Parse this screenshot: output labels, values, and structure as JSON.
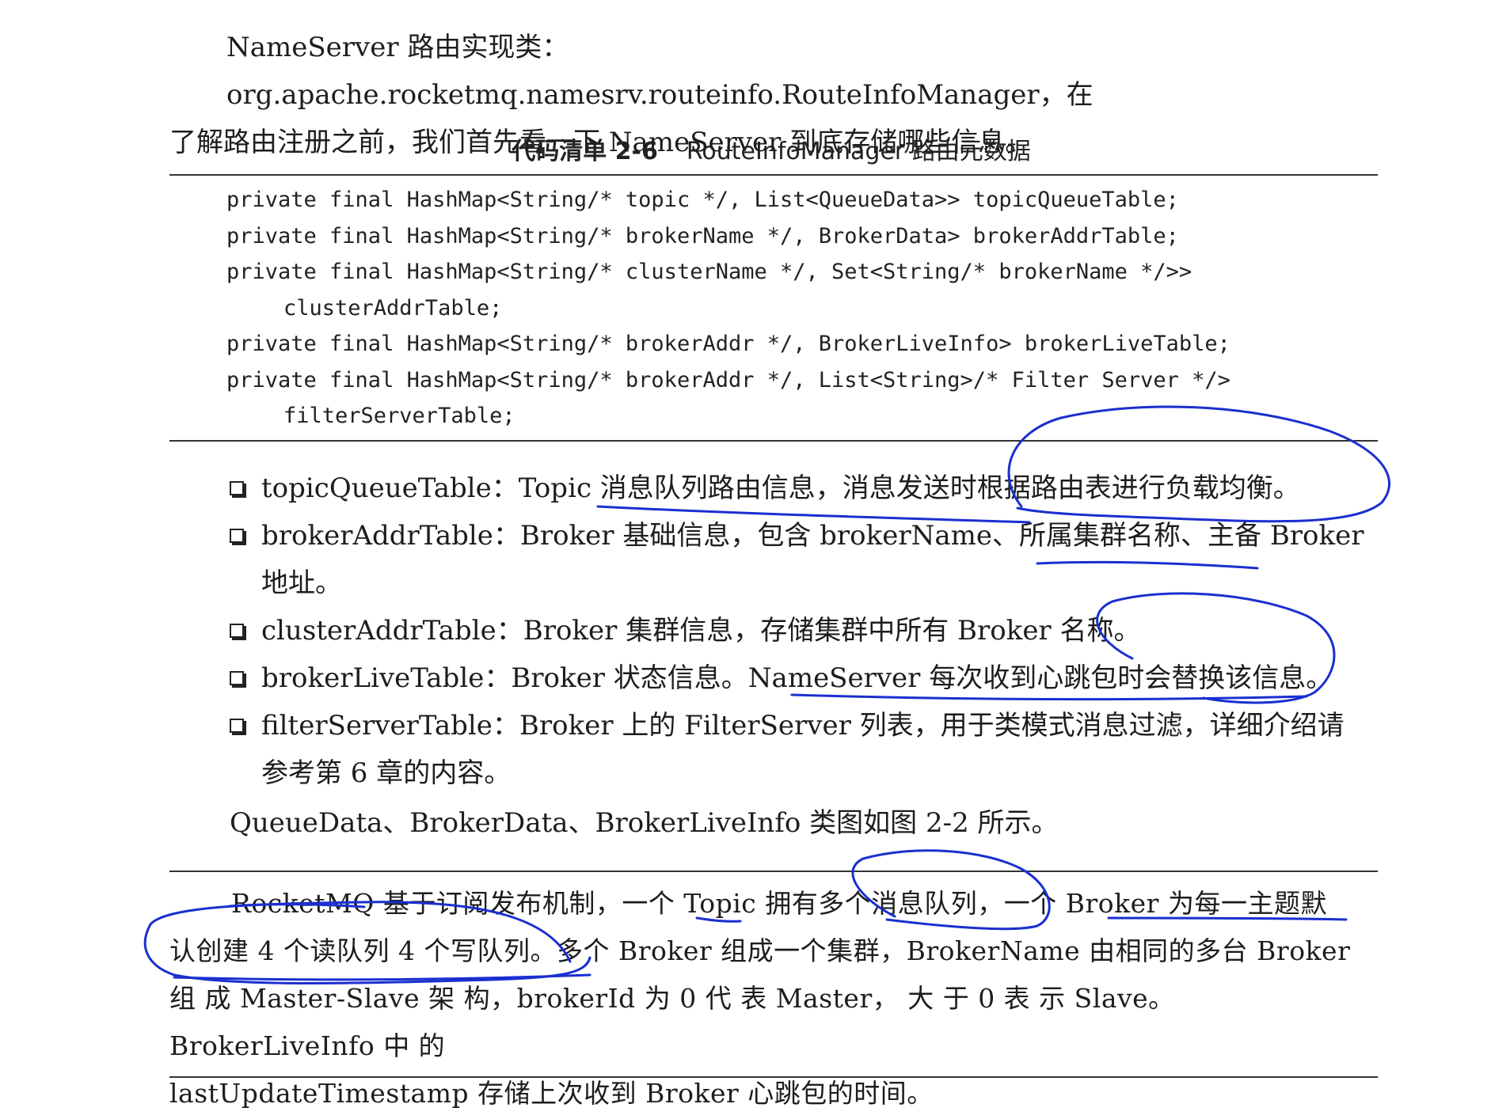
{
  "intro": {
    "line1": "NameServer 路由实现类：org.apache.rocketmq.namesrv.routeinfo.RouteInfoManager，在",
    "line2": "了解路由注册之前，我们首先看一下 NameServer 到底存储哪些信息。"
  },
  "listing": {
    "number": "代码清单 2-6",
    "title": "RouteInfoManager 路由元数据",
    "lines": [
      "private final HashMap<String/* topic */, List<QueueData>> topicQueueTable;",
      "private final HashMap<String/* brokerName */, BrokerData> brokerAddrTable;",
      "private final HashMap<String/* clusterName */, Set<String/* brokerName */>>",
      "clusterAddrTable;",
      "private final HashMap<String/* brokerAddr */, BrokerLiveInfo> brokerLiveTable;",
      "private final HashMap<String/* brokerAddr */, List<String>/* Filter Server */>",
      "filterServerTable;"
    ]
  },
  "bullets": [
    {
      "line1": "topicQueueTable：Topic 消息队列路由信息，消息发送时根据路由表进行负载均衡。",
      "line2": ""
    },
    {
      "line1": "brokerAddrTable：Broker 基础信息，包含 brokerName、所属集群名称、主备 Broker",
      "line2": "地址。"
    },
    {
      "line1": "clusterAddrTable：Broker 集群信息，存储集群中所有 Broker 名称。",
      "line2": ""
    },
    {
      "line1": "brokerLiveTable：Broker 状态信息。NameServer 每次收到心跳包时会替换该信息。",
      "line2": ""
    },
    {
      "line1": "filterServerTable：Broker 上的 FilterServer 列表，用于类模式消息过滤，详细介绍请",
      "line2": "参考第 6 章的内容。"
    }
  ],
  "after_list": "QueueData、BrokerData、BrokerLiveInfo 类图如图 2-2 所示。",
  "note": {
    "line1": "RocketMQ 基于订阅发布机制，一个 Topic 拥有多个消息队列，一个 Broker 为每一主题默",
    "line2": "认创建 4 个读队列 4 个写队列。多个 Broker 组成一个集群，BrokerName 由相同的多台 Broker",
    "line3": "组 成 Master-Slave 架 构，brokerId 为 0 代 表 Master，  大 于 0 表 示 Slave。BrokerLiveInfo 中 的",
    "line4": "lastUpdateTimestamp 存储上次收到 Broker 心跳包的时间。"
  },
  "colors": {
    "ink": "#1a2fd0",
    "text": "#1d1d1d",
    "rule": "#333333"
  }
}
